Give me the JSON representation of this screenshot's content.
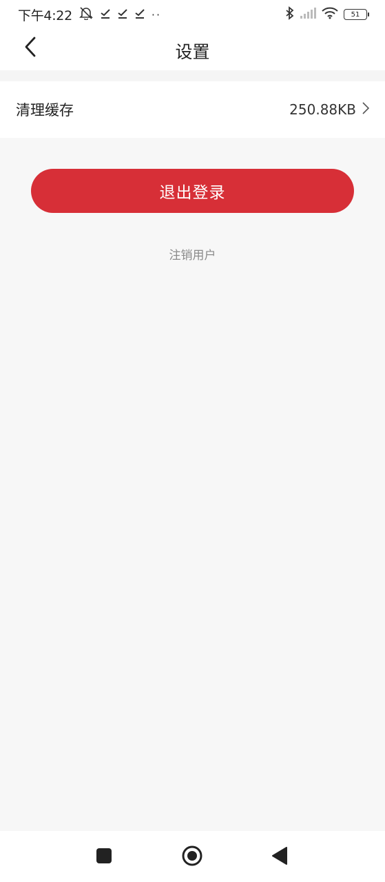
{
  "status_bar": {
    "time": "下午4:22",
    "dots": "··",
    "battery_level": "51",
    "icons": [
      "bell-muted-icon",
      "check-icon",
      "check-icon",
      "check-icon",
      "bluetooth-icon",
      "signal-icon",
      "wifi-icon",
      "battery-icon"
    ]
  },
  "header": {
    "title": "设置",
    "back_icon": "chevron-left-icon"
  },
  "settings": {
    "clear_cache_label": "清理缓存",
    "clear_cache_value": "250.88KB",
    "chevron_icon": "chevron-right-icon"
  },
  "actions": {
    "logout_label": "退出登录",
    "deregister_label": "注销用户"
  },
  "android_nav": {
    "icons": [
      "recent-apps-icon",
      "home-icon",
      "back-triangle-icon"
    ]
  },
  "colors": {
    "accent": "#d72f37",
    "background": "#f7f7f7",
    "surface": "#ffffff",
    "muted_text": "#8a8a8a"
  }
}
